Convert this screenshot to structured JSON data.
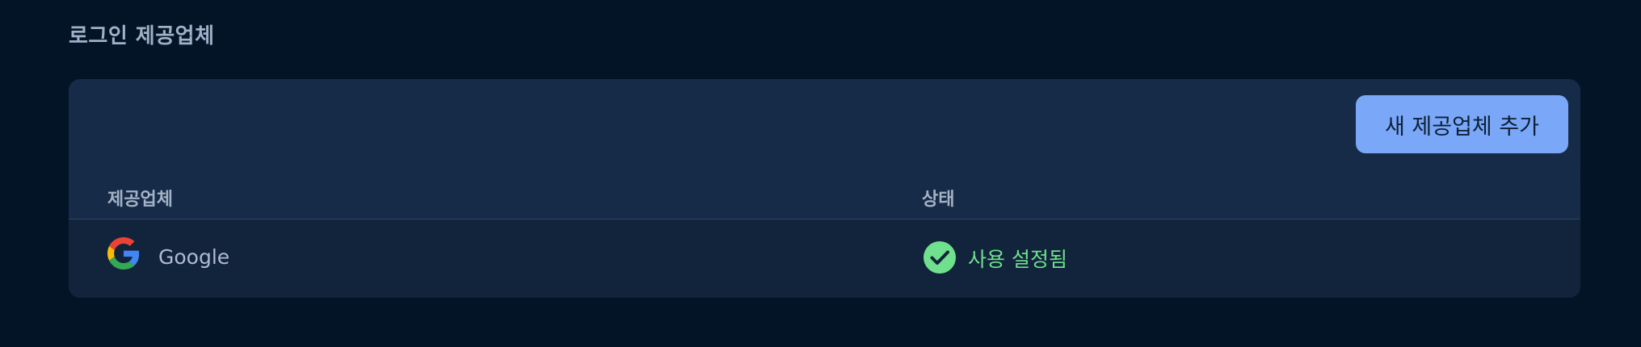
{
  "section": {
    "title": "로그인 제공업체"
  },
  "toolbar": {
    "add_provider_label": "새 제공업체 추가"
  },
  "table": {
    "columns": [
      "제공업체",
      "상태"
    ],
    "rows": [
      {
        "provider": "Google",
        "provider_icon": "google-icon",
        "status": "사용 설정됨",
        "status_icon": "check-circle-icon"
      }
    ]
  },
  "colors": {
    "background": "#031426",
    "panel": "#162b47",
    "table_body": "#12243c",
    "accent_button": "#7aa7f7",
    "status_success": "#6fe08d",
    "text_muted": "#a4b2c6"
  }
}
